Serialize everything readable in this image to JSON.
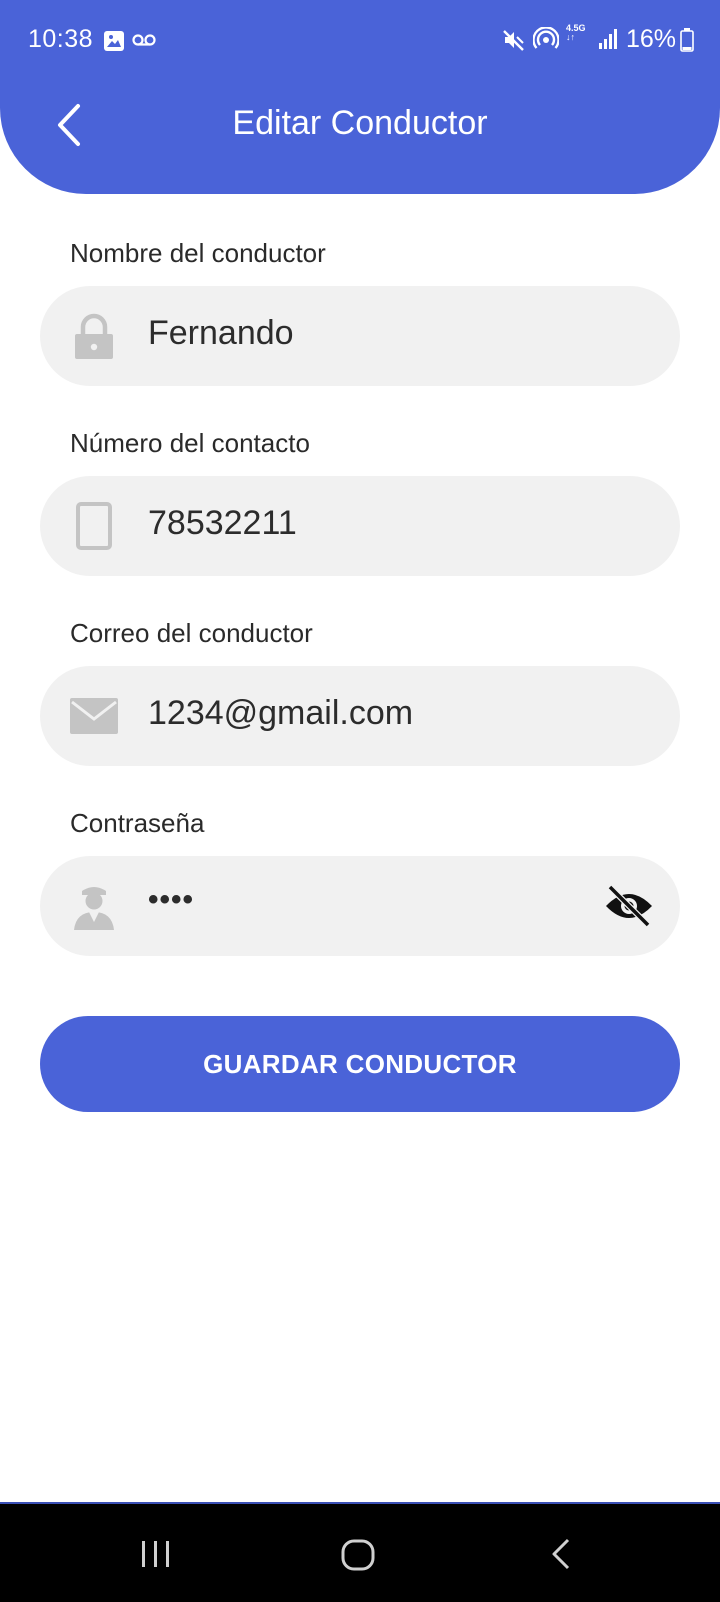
{
  "status_bar": {
    "time": "10:38",
    "battery_percent": "16%",
    "network_label": "4.5G",
    "icons": [
      "image-icon",
      "voicemail-icon",
      "mute-icon",
      "hotspot-icon",
      "network-icon",
      "signal-icon",
      "battery-icon"
    ]
  },
  "header": {
    "title": "Editar Conductor",
    "color": "#4a63d8"
  },
  "form": {
    "name_label": "Nombre del conductor",
    "name_value": "Fernando",
    "phone_label": "Número del contacto",
    "phone_value": "78532211",
    "email_label": "Correo del conductor",
    "email_value": "1234@gmail.com",
    "password_label": "Contraseña",
    "password_value": "••••",
    "field_bg": "#f1f1f1",
    "icon_color": "#c4c4c4"
  },
  "actions": {
    "save_label": "GUARDAR CONDUCTOR"
  }
}
